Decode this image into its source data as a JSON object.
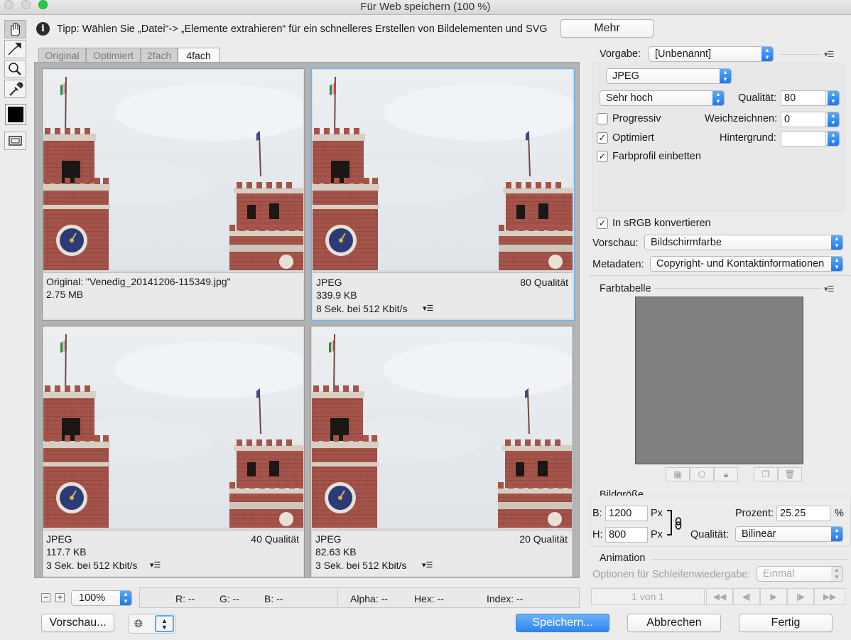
{
  "window": {
    "title": "Für Web speichern (100 %)"
  },
  "tip": {
    "text": "Tipp: Wählen Sie „Datei“-> „Elemente extrahieren“ für ein schnelleres Erstellen von Bildelementen und SVG",
    "more_button": "Mehr"
  },
  "tabs": [
    {
      "label": "Original",
      "active": false
    },
    {
      "label": "Optimiert",
      "active": false
    },
    {
      "label": "2fach",
      "active": false
    },
    {
      "label": "4fach",
      "active": true
    }
  ],
  "panes": [
    {
      "line1_left": "Original: \"Venedig_20141206-115349.jpg\"",
      "line1_right": "",
      "line2": "2.75 MB",
      "line3": "",
      "selected": false
    },
    {
      "line1_left": "JPEG",
      "line1_right": "80 Qualität",
      "line2": "339.9 KB",
      "line3": "8 Sek. bei 512 Kbit/s",
      "selected": true
    },
    {
      "line1_left": "JPEG",
      "line1_right": "40 Qualität",
      "line2": "117.7 KB",
      "line3": "3 Sek. bei 512 Kbit/s",
      "selected": false
    },
    {
      "line1_left": "JPEG",
      "line1_right": "20 Qualität",
      "line2": "82.63 KB",
      "line3": "3 Sek. bei 512 Kbit/s",
      "selected": false
    }
  ],
  "status": {
    "zoom": "100%",
    "r": "R: --",
    "g": "G: --",
    "b": "B: --",
    "alpha": "Alpha: --",
    "hex": "Hex: --",
    "index": "Index: --"
  },
  "settings": {
    "preset_label": "Vorgabe:",
    "preset_value": "[Unbenannt]",
    "format": "JPEG",
    "quality_preset": "Sehr hoch",
    "quality_label": "Qualität:",
    "quality_value": "80",
    "progressive_label": "Progressiv",
    "progressive_checked": false,
    "blur_label": "Weichzeichnen:",
    "blur_value": "0",
    "optimized_label": "Optimiert",
    "optimized_checked": true,
    "matte_label": "Hintergrund:",
    "matte_value": "",
    "embed_profile_label": "Farbprofil einbetten",
    "embed_profile_checked": true,
    "srgb_label": "In sRGB konvertieren",
    "srgb_checked": true,
    "preview_label": "Vorschau:",
    "preview_value": "Bildschirmfarbe",
    "metadata_label": "Metadaten:",
    "metadata_value": "Copyright- und Kontaktinformationen"
  },
  "color_table": {
    "title": "Farbtabelle"
  },
  "image_size": {
    "title": "Bildgröße",
    "w_label": "B:",
    "w_value": "1200",
    "w_unit": "Px",
    "h_label": "H:",
    "h_value": "800",
    "h_unit": "Px",
    "percent_label": "Prozent:",
    "percent_value": "25.25",
    "percent_unit": "%",
    "quality_label": "Qualität:",
    "quality_value": "Bilinear"
  },
  "animation": {
    "title": "Animation",
    "loop_label": "Optionen für Schleifenwiedergabe:",
    "loop_value": "Einmal",
    "frame": "1 von 1"
  },
  "footer": {
    "preview_button": "Vorschau...",
    "save_button": "Speichern...",
    "cancel_button": "Abbrechen",
    "done_button": "Fertig"
  },
  "colors": {
    "accent": "#2f83f1",
    "selection_border": "#7fb2e5",
    "color_table_bg": "#808080"
  }
}
